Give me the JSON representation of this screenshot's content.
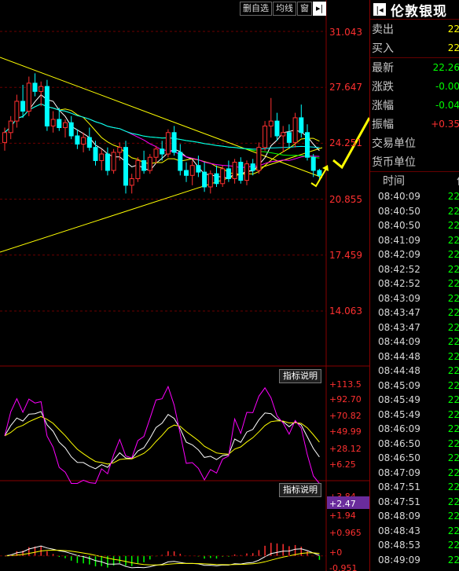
{
  "toolbar": {
    "delete_label": "删自选",
    "ma_label": "均线",
    "window_label": "窗",
    "expand_icon": "arrow-right-bar-icon"
  },
  "price_axis": [
    "31.043",
    "27.647",
    "24.251",
    "20.855",
    "17.459",
    "14.063"
  ],
  "kdj_axis": [
    "+113.5",
    "+92.70",
    "+70.82",
    "+49.99",
    "+28.12",
    "+6.25"
  ],
  "macd_axis": [
    "+3.84",
    "+2.47",
    "+1.94",
    "+0.965",
    "+0",
    "-0.951"
  ],
  "macd_current": "+2.47",
  "indicator_button": "指标说明",
  "colors": {
    "up": "#ff3030",
    "down": "#00ffff",
    "trend_line": "#ffff00",
    "highlight": "#6a2c9c"
  },
  "quote": {
    "title": "伦敦银现",
    "collapse_icon": "arrow-left-bar-icon",
    "sell_label": "卖出",
    "sell_value": "22",
    "buy_label": "买入",
    "buy_value": "22",
    "latest_label": "最新",
    "latest_value": "22.26",
    "change_label": "涨跌",
    "change_value": "-0.00",
    "pct_label": "涨幅",
    "pct_value": "-0.04",
    "amp_label": "振幅",
    "amp_value": "+0.35",
    "unit_label": "交易单位",
    "currency_label": "货币单位"
  },
  "ticks": {
    "time_header": "时间",
    "price_header": "价",
    "rows": [
      {
        "time": "08:40:09",
        "price": "22"
      },
      {
        "time": "08:40:50",
        "price": "22"
      },
      {
        "time": "08:40:50",
        "price": "22"
      },
      {
        "time": "08:41:09",
        "price": "22"
      },
      {
        "time": "08:42:09",
        "price": "22"
      },
      {
        "time": "08:42:52",
        "price": "22"
      },
      {
        "time": "08:42:52",
        "price": "22"
      },
      {
        "time": "08:43:09",
        "price": "22"
      },
      {
        "time": "08:43:47",
        "price": "22"
      },
      {
        "time": "08:43:47",
        "price": "22"
      },
      {
        "time": "08:44:09",
        "price": "22"
      },
      {
        "time": "08:44:48",
        "price": "22"
      },
      {
        "time": "08:44:48",
        "price": "22"
      },
      {
        "time": "08:45:09",
        "price": "22"
      },
      {
        "time": "08:45:49",
        "price": "22"
      },
      {
        "time": "08:45:49",
        "price": "22"
      },
      {
        "time": "08:46:09",
        "price": "22"
      },
      {
        "time": "08:46:50",
        "price": "22"
      },
      {
        "time": "08:46:50",
        "price": "22"
      },
      {
        "time": "08:47:09",
        "price": "22"
      },
      {
        "time": "08:47:51",
        "price": "22"
      },
      {
        "time": "08:47:51",
        "price": "22"
      },
      {
        "time": "08:48:09",
        "price": "22"
      },
      {
        "time": "08:48:43",
        "price": "22"
      },
      {
        "time": "08:48:53",
        "price": "22"
      },
      {
        "time": "08:49:09",
        "price": "22"
      }
    ]
  },
  "chart_data": {
    "type": "candlestick",
    "ylim": [
      14.063,
      31.043
    ],
    "candles": [
      [
        24.3,
        25.2,
        23.8,
        24.9
      ],
      [
        24.9,
        25.9,
        24.5,
        25.6
      ],
      [
        25.6,
        27.2,
        25.2,
        26.8
      ],
      [
        26.8,
        27.8,
        25.8,
        26.2
      ],
      [
        26.2,
        28.3,
        25.9,
        27.9
      ],
      [
        27.9,
        28.5,
        27.1,
        27.4
      ],
      [
        27.4,
        28.0,
        26.5,
        27.7
      ],
      [
        27.7,
        28.1,
        25.0,
        25.3
      ],
      [
        25.3,
        26.2,
        24.9,
        25.7
      ],
      [
        25.7,
        26.4,
        25.0,
        25.2
      ],
      [
        25.2,
        25.7,
        24.6,
        25.5
      ],
      [
        25.5,
        25.9,
        24.5,
        24.7
      ],
      [
        24.7,
        25.1,
        23.9,
        24.2
      ],
      [
        24.2,
        24.9,
        23.7,
        24.6
      ],
      [
        24.6,
        25.2,
        23.8,
        24.0
      ],
      [
        24.0,
        24.4,
        22.9,
        23.2
      ],
      [
        23.2,
        23.9,
        22.6,
        23.6
      ],
      [
        23.6,
        24.0,
        22.3,
        22.6
      ],
      [
        22.6,
        23.9,
        22.4,
        23.7
      ],
      [
        23.7,
        24.3,
        23.2,
        24.0
      ],
      [
        24.0,
        24.4,
        21.2,
        21.7
      ],
      [
        21.7,
        22.4,
        21.2,
        22.1
      ],
      [
        22.1,
        23.4,
        21.9,
        23.2
      ],
      [
        23.2,
        23.8,
        22.4,
        22.6
      ],
      [
        22.6,
        23.6,
        22.4,
        23.4
      ],
      [
        23.4,
        24.1,
        23.0,
        23.9
      ],
      [
        23.9,
        24.4,
        23.2,
        23.6
      ],
      [
        23.6,
        25.1,
        23.4,
        24.9
      ],
      [
        24.9,
        25.3,
        23.5,
        23.7
      ],
      [
        23.7,
        24.2,
        22.3,
        22.6
      ],
      [
        22.6,
        23.1,
        21.9,
        22.3
      ],
      [
        22.3,
        23.2,
        21.7,
        22.9
      ],
      [
        22.9,
        23.5,
        22.2,
        22.5
      ],
      [
        22.5,
        23.1,
        21.3,
        21.6
      ],
      [
        21.6,
        22.6,
        21.2,
        22.4
      ],
      [
        22.4,
        22.9,
        21.6,
        21.8
      ],
      [
        21.8,
        22.9,
        21.6,
        22.7
      ],
      [
        22.7,
        23.2,
        21.9,
        22.1
      ],
      [
        22.1,
        23.3,
        21.8,
        23.1
      ],
      [
        23.1,
        23.4,
        21.8,
        22.0
      ],
      [
        22.0,
        23.2,
        21.7,
        23.0
      ],
      [
        23.0,
        23.3,
        22.3,
        22.6
      ],
      [
        22.6,
        24.3,
        22.4,
        24.0
      ],
      [
        24.0,
        25.6,
        23.8,
        25.3
      ],
      [
        25.3,
        27.0,
        24.6,
        25.6
      ],
      [
        25.6,
        26.1,
        24.4,
        24.7
      ],
      [
        24.7,
        25.3,
        23.7,
        24.9
      ],
      [
        24.9,
        25.4,
        24.0,
        24.3
      ],
      [
        24.3,
        26.1,
        24.0,
        25.8
      ],
      [
        25.8,
        26.6,
        24.6,
        24.9
      ],
      [
        24.9,
        25.4,
        23.2,
        23.4
      ],
      [
        23.4,
        23.6,
        22.2,
        22.6
      ],
      [
        22.6,
        22.7,
        22.0,
        22.3
      ]
    ]
  }
}
